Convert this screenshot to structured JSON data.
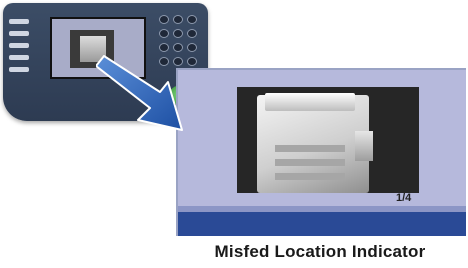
{
  "caption": "Misfed Location Indicator",
  "screen": {
    "page_indicator": "1/4"
  },
  "colors": {
    "panel": "#34445d",
    "screen_background": "#b6b9dc",
    "status_bar": "#2a4a96",
    "arrow": "#2563b8",
    "start_button": "#3a9a3a"
  },
  "icons": {
    "arrow": "zoom-arrow-icon",
    "start": "start-button-icon"
  }
}
